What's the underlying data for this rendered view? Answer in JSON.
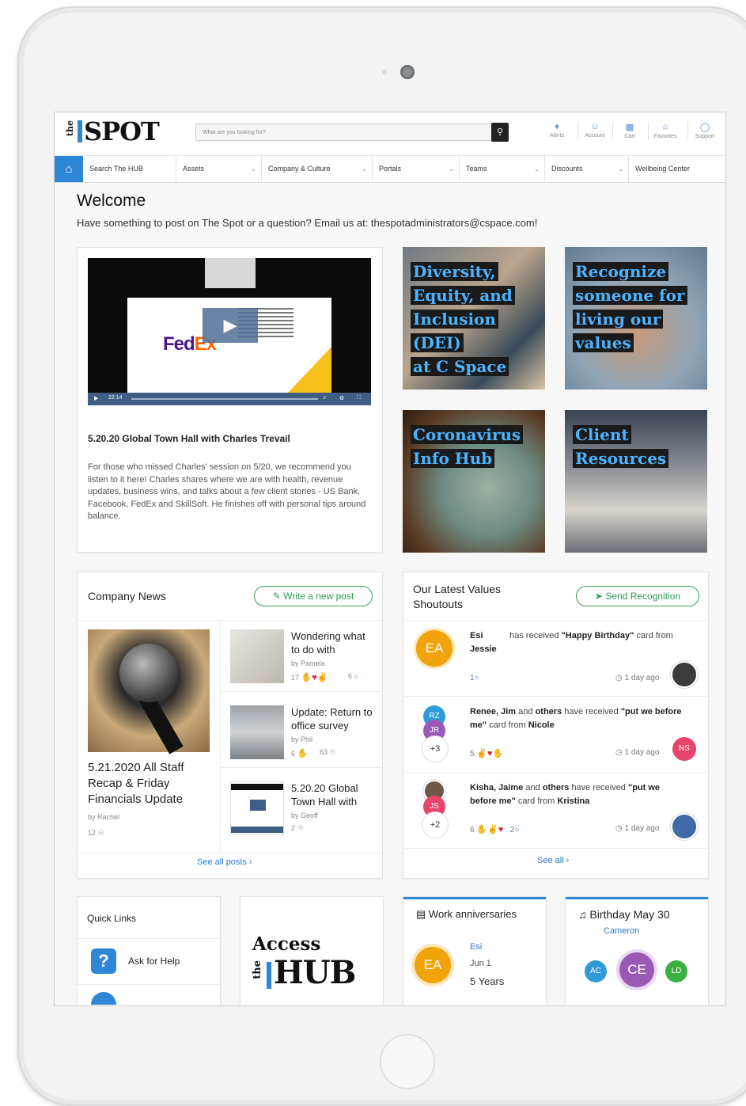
{
  "header": {
    "logo_the": "the",
    "logo_text": "SPOT",
    "search_placeholder": "What are you looking for?",
    "icons": [
      {
        "label": "Alerts",
        "icon": "bell-icon"
      },
      {
        "label": "Account",
        "icon": "user-icon"
      },
      {
        "label": "Cart",
        "icon": "cart-icon"
      },
      {
        "label": "Favorites",
        "icon": "star-icon"
      },
      {
        "label": "Support",
        "icon": "support-icon"
      }
    ]
  },
  "nav": {
    "items": [
      "Search The HUB",
      "Assets",
      "Company & Culture",
      "Portals",
      "Teams",
      "Discounts",
      "Wellbeing Center"
    ]
  },
  "welcome": {
    "title": "Welcome",
    "subtitle": "Have something to post on The Spot or a question? Email us at: thespotadministrators@cspace.com!"
  },
  "feature": {
    "video_time": "22:14",
    "slide_logo_fe": "Fed",
    "slide_logo_ex": "Ex",
    "title": "5.20.20 Global Town Hall with Charles Trevail",
    "body": "For those who missed Charles' session on 5/20, we recommend you listen to it here! Charles shares where we are with health, revenue updates, business wins, and talks about a few client stories - US Bank, Facebook, FedEx and SkillSoft. He finishes off with personal tips around balance."
  },
  "tiles": [
    {
      "lines": [
        "Diversity,",
        "Equity, and",
        "Inclusion (DEI)",
        "at C Space"
      ]
    },
    {
      "lines": [
        "Recognize",
        "someone for",
        "living our",
        "values"
      ]
    },
    {
      "lines": [
        "Coronavirus",
        "Info Hub"
      ]
    },
    {
      "lines": [
        "Client",
        "Resources"
      ]
    }
  ],
  "news": {
    "title": "Company News",
    "write_label": "Write a new post",
    "main": {
      "title": "5.21.2020 All Staff Recap & Friday Financials Update",
      "author": "by Rachel",
      "views": "12"
    },
    "items": [
      {
        "title": "Wondering what to do with",
        "author": "by Pamela",
        "reactions": "17",
        "comments": "6"
      },
      {
        "title": "Update: Return to office survey",
        "author": "by Phil",
        "reactions": "6",
        "views": "63"
      },
      {
        "title": "5.20.20 Global Town Hall with",
        "author": "by Geoff",
        "views": "2"
      }
    ],
    "see_all": "See all posts ›"
  },
  "shoutouts": {
    "title": "Our Latest Values Shoutouts",
    "send_label": "Send Recognition",
    "items": [
      {
        "who": "Esi",
        "verb": "has received",
        "card": "\"Happy Birthday\"",
        "suffix": "card",
        "from_label": "from",
        "from": "Jessie",
        "count": "1",
        "time": "1 day ago",
        "initials": "EA"
      },
      {
        "who": "Renee, Jim",
        "mid": "and",
        "others": "others",
        "verb": "have received",
        "card": "\"put we before me\"",
        "suffix": "card from",
        "from": "Nicole",
        "count": "5",
        "time": "1 day ago",
        "initials": [
          "RZ",
          "JR",
          "+3"
        ],
        "sender_initials": "NS"
      },
      {
        "who": "Kisha, Jaime",
        "mid": "and",
        "others": "others",
        "verb": "have received",
        "card": "\"put we before me\"",
        "suffix": "card from",
        "from": "Kristina",
        "count": "6",
        "comments": "2",
        "time": "1 day ago",
        "initials": [
          "JS",
          "+2"
        ]
      }
    ],
    "see_all": "See all ›"
  },
  "quick_links": {
    "title": "Quick Links",
    "items": [
      "Ask for Help"
    ]
  },
  "access_hub": {
    "line1": "Access",
    "the": "the",
    "hub": "HUB"
  },
  "anniversaries": {
    "title": "Work anniversaries",
    "name": "Esi",
    "date": "Jun 1",
    "years": "5 Years",
    "initials": "EA"
  },
  "birthday": {
    "title": "Birthday May 30",
    "name": "Cameron",
    "initials": [
      "AC",
      "CE",
      "LD"
    ]
  },
  "colors": {
    "accent": "#2e86d6",
    "green": "#37a35a",
    "orange": "#f0a30a",
    "purple": "#9b59b6",
    "pink": "#e8456b"
  }
}
